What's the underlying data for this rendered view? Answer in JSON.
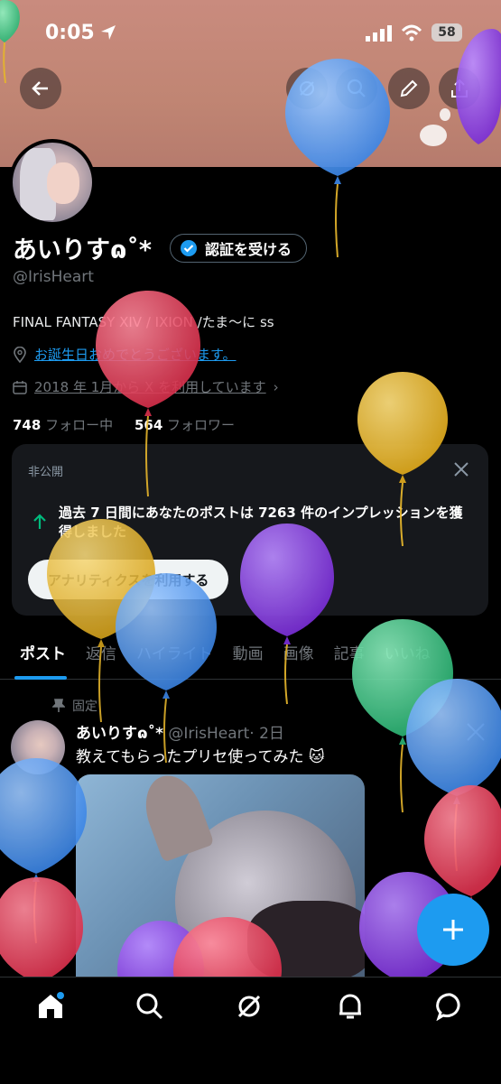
{
  "status_bar": {
    "time": "0:05",
    "battery": "58"
  },
  "profile": {
    "display_name": "あいりすɷ˚*",
    "verify_button": "認証を受ける",
    "handle": "@IrisHeart",
    "bio": "FINAL FANTASY XIV / IXION /たま〜に ss",
    "birthday_text": "お誕生日おめでとうございます。",
    "joined_text": "2018 年 1月から X を利用しています",
    "following_count": "748",
    "following_label": "フォロー中",
    "followers_count": "564",
    "followers_label": "フォロワー"
  },
  "analytics_card": {
    "private_label": "非公開",
    "message": "過去 7 日間にあなたのポストは 7263 件のインプレッションを獲得しました",
    "button_label": "アナリティクスを利用する"
  },
  "tabs": [
    "ポスト",
    "返信",
    "ハイライト",
    "動画",
    "画像",
    "記事",
    "いいね"
  ],
  "pinned_post": {
    "pinned_label": "固定",
    "author_name": "あいりすɷ˚*",
    "author_handle": "@IrisHeart",
    "time": "· 2日",
    "text": "教えてもらったプリセ使ってみた 🐱"
  },
  "colors": {
    "accent": "#1d9bf0",
    "balloon_blue": "#4a9af0",
    "balloon_red": "#e8405a",
    "balloon_yellow": "#e5b52c",
    "balloon_purple": "#8b3fe0",
    "balloon_green": "#3fc98a"
  },
  "icons": [
    "back-icon",
    "search-icon",
    "edit-icon",
    "share-icon",
    "verified-icon",
    "location-icon",
    "calendar-icon",
    "close-icon",
    "arrow-up-icon",
    "pin-icon",
    "x-logo-icon",
    "home-icon",
    "explore-icon",
    "grok-icon",
    "notifications-icon",
    "messages-icon",
    "plus-icon"
  ]
}
